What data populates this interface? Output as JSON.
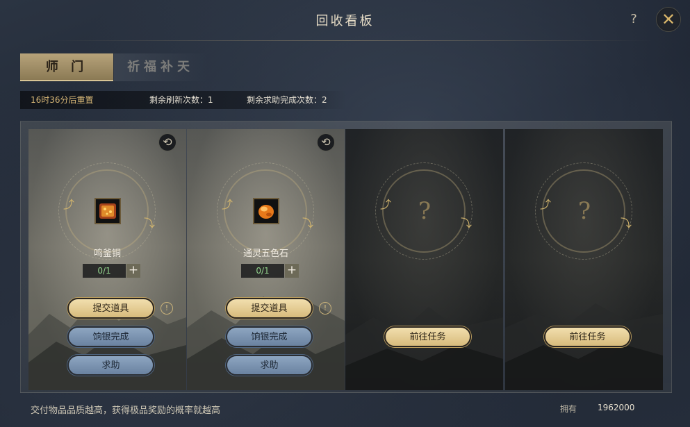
{
  "window": {
    "title": "回收看板",
    "help_label": "?",
    "close_label": "✕"
  },
  "tabs": [
    {
      "label": "师 门",
      "active": true
    },
    {
      "label": "祈福补天",
      "active": false
    }
  ],
  "info": {
    "reset_time": "16时36分后重置",
    "refresh_remaining": "剩余刷新次数：1",
    "help_remaining": "剩余求助完成次数：2"
  },
  "cards": [
    {
      "item_name": "鸣釜铜",
      "count": "0/1",
      "submit_label": "提交道具",
      "silver_label": "饷银完成",
      "help_label": "求助",
      "warn": "!",
      "refresh": "⟲",
      "item_icon": "copper-ore-icon"
    },
    {
      "item_name": "通灵五色石",
      "count": "0/1",
      "submit_label": "提交道具",
      "silver_label": "饷银完成",
      "help_label": "求助",
      "warn": "!",
      "refresh": "⟲",
      "item_icon": "five-color-stone-icon"
    },
    {
      "unknown": "?",
      "goto_label": "前往任务"
    },
    {
      "unknown": "?",
      "goto_label": "前往任务"
    }
  ],
  "footer": {
    "tip": "交付物品品质越高，获得极品奖励的概率就越高",
    "owned_label": "拥有",
    "silver_amount": "1962000"
  },
  "colors": {
    "gold_button": "#d7bb7c",
    "blue_button": "#6a82a0",
    "accent": "#d6b676",
    "count_green": "#93d48d"
  }
}
